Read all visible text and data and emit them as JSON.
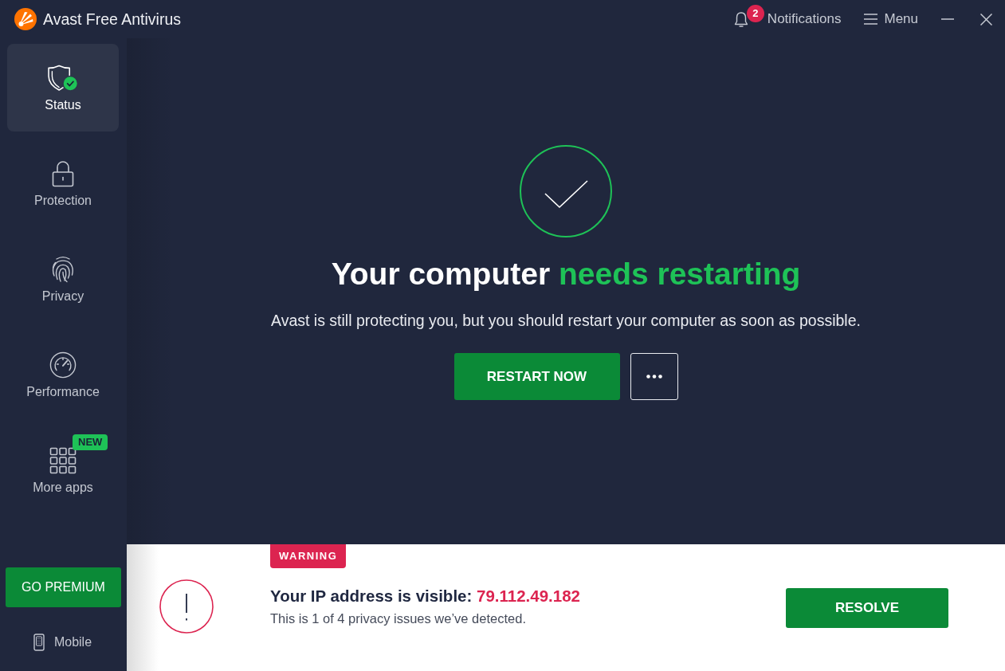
{
  "window": {
    "title": "Avast Free Antivirus"
  },
  "header": {
    "notifications": {
      "label": "Notifications",
      "count": "2"
    },
    "menu": {
      "label": "Menu"
    }
  },
  "sidebar": {
    "items": [
      {
        "kind": "status",
        "label": "Status",
        "selected": true
      },
      {
        "kind": "protection",
        "label": "Protection",
        "selected": false
      },
      {
        "kind": "privacy",
        "label": "Privacy",
        "selected": false
      },
      {
        "kind": "performance",
        "label": "Performance",
        "selected": false
      },
      {
        "kind": "apps",
        "label": "More apps",
        "selected": false,
        "badge": "NEW"
      }
    ],
    "premium_button": "GO PREMIUM",
    "mobile": {
      "label": "Mobile"
    }
  },
  "status": {
    "heading": "Your computer",
    "heading_highlight": "needs restarting",
    "message": "Avast is still protecting you, but you should restart your computer as soon as possible.",
    "primary_button": "RESTART NOW"
  },
  "alert": {
    "badge": "WARNING",
    "title": "Your IP address is visible:",
    "value": "79.112.49.182",
    "detail": "This is 1 of 4 privacy issues we’ve detected.",
    "button": "RESOLVE"
  }
}
